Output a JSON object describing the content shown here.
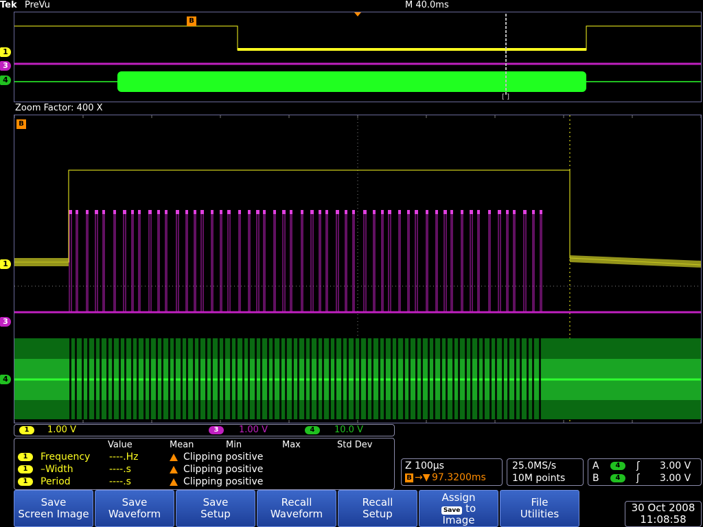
{
  "header": {
    "logo": "Tek",
    "mode": "PreVu",
    "timebase": "M 40.0ms"
  },
  "overview": {
    "trigger_marker": "B",
    "bracket_marker": "[ ]"
  },
  "zoom": {
    "label": "Zoom Factor: 400 X"
  },
  "channels": [
    {
      "id": "1",
      "scale": "1.00 V",
      "color": "#ffff20"
    },
    {
      "id": "3",
      "scale": "1.00 V",
      "color": "#c020c0"
    },
    {
      "id": "4",
      "scale": "10.0 V",
      "color": "#20c020"
    }
  ],
  "measurements": {
    "headers": [
      "Value",
      "Mean",
      "Min",
      "Max",
      "Std Dev"
    ],
    "rows": [
      {
        "channel": "1",
        "name": "Frequency",
        "value": "----.Hz",
        "warning": "Clipping positive"
      },
      {
        "channel": "1",
        "name": "–Width",
        "value": "----.s",
        "warning": "Clipping positive"
      },
      {
        "channel": "1",
        "name": "Period",
        "value": "----.s",
        "warning": "Clipping positive"
      }
    ]
  },
  "zoom_readout": {
    "zoom": "Z 100µs",
    "position": "97.3200ms",
    "trigger_letter": "B"
  },
  "acquisition": {
    "rate": "25.0MS/s",
    "length": "10M points"
  },
  "trigger": {
    "rows": [
      {
        "letter": "A",
        "channel": "4",
        "level": "3.00 V"
      },
      {
        "letter": "B",
        "channel": "4",
        "level": "3.00 V"
      }
    ]
  },
  "softkeys": [
    {
      "line1": "Save",
      "line2": "Screen Image"
    },
    {
      "line1": "Save",
      "line2": "Waveform"
    },
    {
      "line1": "Save",
      "line2": "Setup"
    },
    {
      "line1": "Recall",
      "line2": "Waveform"
    },
    {
      "line1": "Recall",
      "line2": "Setup"
    },
    {
      "line1": "Assign",
      "badge": "Save",
      "line2": "to",
      "line3": "Image"
    },
    {
      "line1": "File",
      "line2": "Utilities"
    }
  ],
  "datetime": {
    "date": "30 Oct  2008",
    "time": "11:08:58"
  },
  "colors": {
    "ch1": "#ffff20",
    "ch3": "#c020c0",
    "ch4": "#20c020",
    "trigger_marker": "#ff8c00",
    "softkey": "#2a52b8"
  }
}
